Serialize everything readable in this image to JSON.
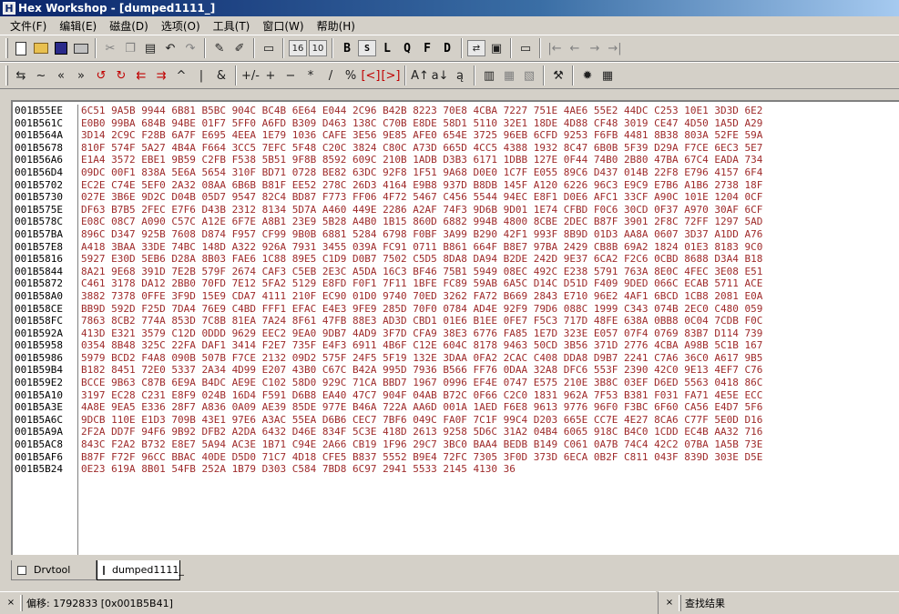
{
  "window": {
    "title": "Hex Workshop - [dumped1111_]",
    "app_icon": "hex-app-icon"
  },
  "menu": [
    "文件(F)",
    "编辑(E)",
    "磁盘(D)",
    "选项(O)",
    "工具(T)",
    "窗口(W)",
    "帮助(H)"
  ],
  "toolbar1": {
    "icons": [
      "new-file-icon",
      "open-folder-icon",
      "save-disk-icon",
      "print-icon",
      "cut-icon",
      "copy-icon",
      "paste-icon",
      "undo-icon",
      "redo-icon",
      "insert-mode-icon",
      "overwrite-mode-icon",
      "view-icon",
      "hex-16-icon",
      "hex-10-icon"
    ],
    "hex16_label": "16",
    "hex10_label": "10",
    "format_letters": [
      "B",
      "S",
      "L",
      "Q",
      "F",
      "D"
    ],
    "nav_icons": [
      "first-icon",
      "prev-icon",
      "next-icon",
      "last-icon"
    ]
  },
  "toolbar2": {
    "ops": [
      "⇆",
      "~",
      "«",
      "»",
      "↺",
      "↻",
      "⇇",
      "⇉",
      "^",
      "|",
      "&",
      "+/-",
      "+",
      "−",
      "*",
      "/",
      "%",
      "[<]",
      "[>]",
      "A↑",
      "a↓",
      "ą"
    ]
  },
  "hex_view": {
    "rows": [
      {
        "addr": "001B55EE",
        "hex": "6C51 9A5B 9944 6B81 B5BC 904C BC4B 6E64 E044 2C96 B42B 8223 70E8 4CBA 7227 751E 4AE6 55E2 44DC C253 10E1 3D3D 6E2"
      },
      {
        "addr": "001B561C",
        "hex": "E0B0 99BA 684B 94BE 01F7 5FF0 A6FD B309 D463 138C C70B E8DE 58D1 5110 32E1 18DE 4D88 CF48 3019 CE47 4D50 1A5D A29"
      },
      {
        "addr": "001B564A",
        "hex": "3D14 2C9C F28B 6A7F E695 4EEA 1E79 1036 CAFE 3E56 9E85 AFE0 654E 3725 96EB 6CFD 9253 F6FB 4481 8B38 803A 52FE 59A"
      },
      {
        "addr": "001B5678",
        "hex": "810F 574F 5A27 4B4A F664 3CC5 7EFC 5F48 C20C 3824 C80C A73D 665D 4CC5 4388 1932 8C47 6B0B 5F39 D29A F7CE 6EC3 5E7"
      },
      {
        "addr": "001B56A6",
        "hex": "E1A4 3572 EBE1 9B59 C2FB F538 5B51 9F8B 8592 609C 210B 1ADB D3B3 6171 1DBB 127E 0F44 74B0 2B80 47BA 67C4 EADA 734"
      },
      {
        "addr": "001B56D4",
        "hex": "09DC 00F1 838A 5E6A 5654 310F BD71 0728 BE82 63DC 92F8 1F51 9A68 D0E0 1C7F E055 89C6 D437 014B 22F8 E796 4157 6F4"
      },
      {
        "addr": "001B5702",
        "hex": "EC2E C74E 5EF0 2A32 08AA 6B6B B81F EE52 278C 26D3 4164 E9B8 937D B8DB 145F A120 6226 96C3 E9C9 E7B6 A1B6 2738 18F"
      },
      {
        "addr": "001B5730",
        "hex": "027E 3B6E 9D2C D04B 05D7 9547 82C4 BD87 F773 FF06 4F72 5467 C456 5544 94EC E8F1 D0E6 AFC1 33CF A90C 101E 1204 0CF"
      },
      {
        "addr": "001B575E",
        "hex": "DF63 B7B5 2FEC E7F6 D43B 2312 8134 5D7A A460 449E 2286 A2AF 74F3 9D6B 9D01 1E74 CFBD F0C6 30CD 0F37 A970 30AF 6CF"
      },
      {
        "addr": "001B578C",
        "hex": "E08C 08C7 A090 C57C A12E 6F7E A8B1 23E9 5B28 A4B0 1B15 860D 6882 994B 4800 8CBE 2DEC B87F 3901 2F8C 72FF 1297 5AD"
      },
      {
        "addr": "001B57BA",
        "hex": "896C D347 925B 7608 D874 F957 CF99 9B0B 6881 5284 6798 F0BF 3A99 B290 42F1 993F 8B9D 01D3 AA8A 0607 3D37 A1DD A76"
      },
      {
        "addr": "001B57E8",
        "hex": "A418 3BAA 33DE 74BC 148D A322 926A 7931 3455 039A FC91 0711 B861 664F B8E7 97BA 2429 CB8B 69A2 1824 01E3 8183 9C0"
      },
      {
        "addr": "001B5816",
        "hex": "5927 E30D 5EB6 D28A 8B03 FAE6 1C88 89E5 C1D9 D0B7 7502 C5D5 8DA8 DA94 B2DE 242D 9E37 6CA2 F2C6 0CBD 8688 D3A4 B18"
      },
      {
        "addr": "001B5844",
        "hex": "8A21 9E68 391D 7E2B 579F 2674 CAF3 C5EB 2E3C A5DA 16C3 BF46 75B1 5949 08EC 492C E238 5791 763A 8E0C 4FEC 3E08 E51"
      },
      {
        "addr": "001B5872",
        "hex": "C461 3178 DA12 2BB0 70FD 7E12 5FA2 5129 E8FD F0F1 7F11 1BFE FC89 59AB 6A5C D14C D51D F409 9DED 066C ECAB 5711 ACE"
      },
      {
        "addr": "001B58A0",
        "hex": "3882 7378 0FFE 3F9D 15E9 CDA7 4111 210F EC90 01D0 9740 70ED 3262 FA72 B669 2843 E710 96E2 4AF1 6BCD 1CB8 2081 E0A"
      },
      {
        "addr": "001B58CE",
        "hex": "BB9D 592D F25D 7DA4 76E9 C4BD FFF1 EFAC E4E3 9FE9 285D 70F0 0784 AD4E 92F9 79D6 088C 1999 C343 074B 2EC0 C480 059"
      },
      {
        "addr": "001B58FC",
        "hex": "7863 8CB2 774A 853D 7C8B 81EA 7A24 8F61 47FB 88E3 AD3D CBD1 01E6 B1EE 0FE7 F5C3 717D 48FE 638A 0BB8 0C04 7CDB F0C"
      },
      {
        "addr": "001B592A",
        "hex": "413D E321 3579 C12D 0DDD 9629 EEC2 9EA0 9DB7 4AD9 3F7D CFA9 38E3 6776 FA85 1E7D 323E E057 07F4 0769 83B7 D114 739"
      },
      {
        "addr": "001B5958",
        "hex": "0354 8B48 325C 22FA DAF1 3414 F2E7 735F E4F3 6911 4B6F C12E 604C 8178 9463 50CD 3B56 371D 2776 4CBA A98B 5C1B 167"
      },
      {
        "addr": "001B5986",
        "hex": "5979 BCD2 F4A8 090B 507B F7CE 2132 09D2 575F 24F5 5F19 132E 3DAA 0FA2 2CAC C408 DDA8 D9B7 2241 C7A6 36C0 A617 9B5"
      },
      {
        "addr": "001B59B4",
        "hex": "B182 8451 72E0 5337 2A34 4D99 E207 43B0 C67C B42A 995D 7936 B566 FF76 0DAA 32A8 DFC6 553F 2390 42C0 9E13 4EF7 C76"
      },
      {
        "addr": "001B59E2",
        "hex": "BCCE 9B63 C87B 6E9A B4DC AE9E C102 58D0 929C 71CA BBD7 1967 0996 EF4E 0747 E575 210E 3B8C 03EF D6ED 5563 0418 86C"
      },
      {
        "addr": "001B5A10",
        "hex": "3197 EC28 C231 E8F9 024B 16D4 F591 D6B8 EA40 47C7 904F 04AB B72C 0F66 C2C0 1831 962A 7F53 B381 F031 FA71 4E5E ECC"
      },
      {
        "addr": "001B5A3E",
        "hex": "4A8E 9EA5 E336 28F7 A836 0A09 AE39 85DE 977E B46A 722A AA6D 001A 1AED F6E8 9613 9776 96F0 F3BC 6F60 CA56 E4D7 5F6"
      },
      {
        "addr": "001B5A6C",
        "hex": "9DCB 110E E1D3 709B 43E1 97E6 A3AC 55EA D6B6 CEC7 7BF6 049C FA0F 7C1F 99C4 D203 665E CC7E 4E27 8CA6 C77F 5E0D D16"
      },
      {
        "addr": "001B5A9A",
        "hex": "2F2A DD7F 94F6 9B92 DFB2 A2DA 6432 D46E 834F 5C3E 418D 2613 9258 5D6C 31A2 04B4 6065 918C B4C0 1CDD EC4B AA32 716"
      },
      {
        "addr": "001B5AC8",
        "hex": "843C F2A2 B732 E8E7 5A94 AC3E 1B71 C94E 2A66 CB19 1F96 29C7 3BC0 BAA4 BEDB B149 C061 0A7B 74C4 42C2 07BA 1A5B 73E"
      },
      {
        "addr": "001B5AF6",
        "hex": "B87F F72F 96CC BBAC 40DE D5D0 71C7 4D18 CFE5 B837 5552 B9E4 72FC 7305 3F0D 373D 6ECA 0B2F C811 043F 839D 303E D5E"
      },
      {
        "addr": "001B5B24",
        "hex": "0E23 619A 8B01 54FB 252A 1B79 D303 C584 7BD8 6C97 2941 5533 2145 4130 36"
      }
    ]
  },
  "tabs": [
    {
      "label": "Drvtool",
      "icon": "document-icon",
      "active": false
    },
    {
      "label": "dumped1111_",
      "icon": "document-icon",
      "active": true
    }
  ],
  "status": {
    "left_close": "×",
    "offset_text": "偏移: 1792833 [0x001B5B41]",
    "right_close": "×",
    "find_results_label": "查找结果"
  }
}
